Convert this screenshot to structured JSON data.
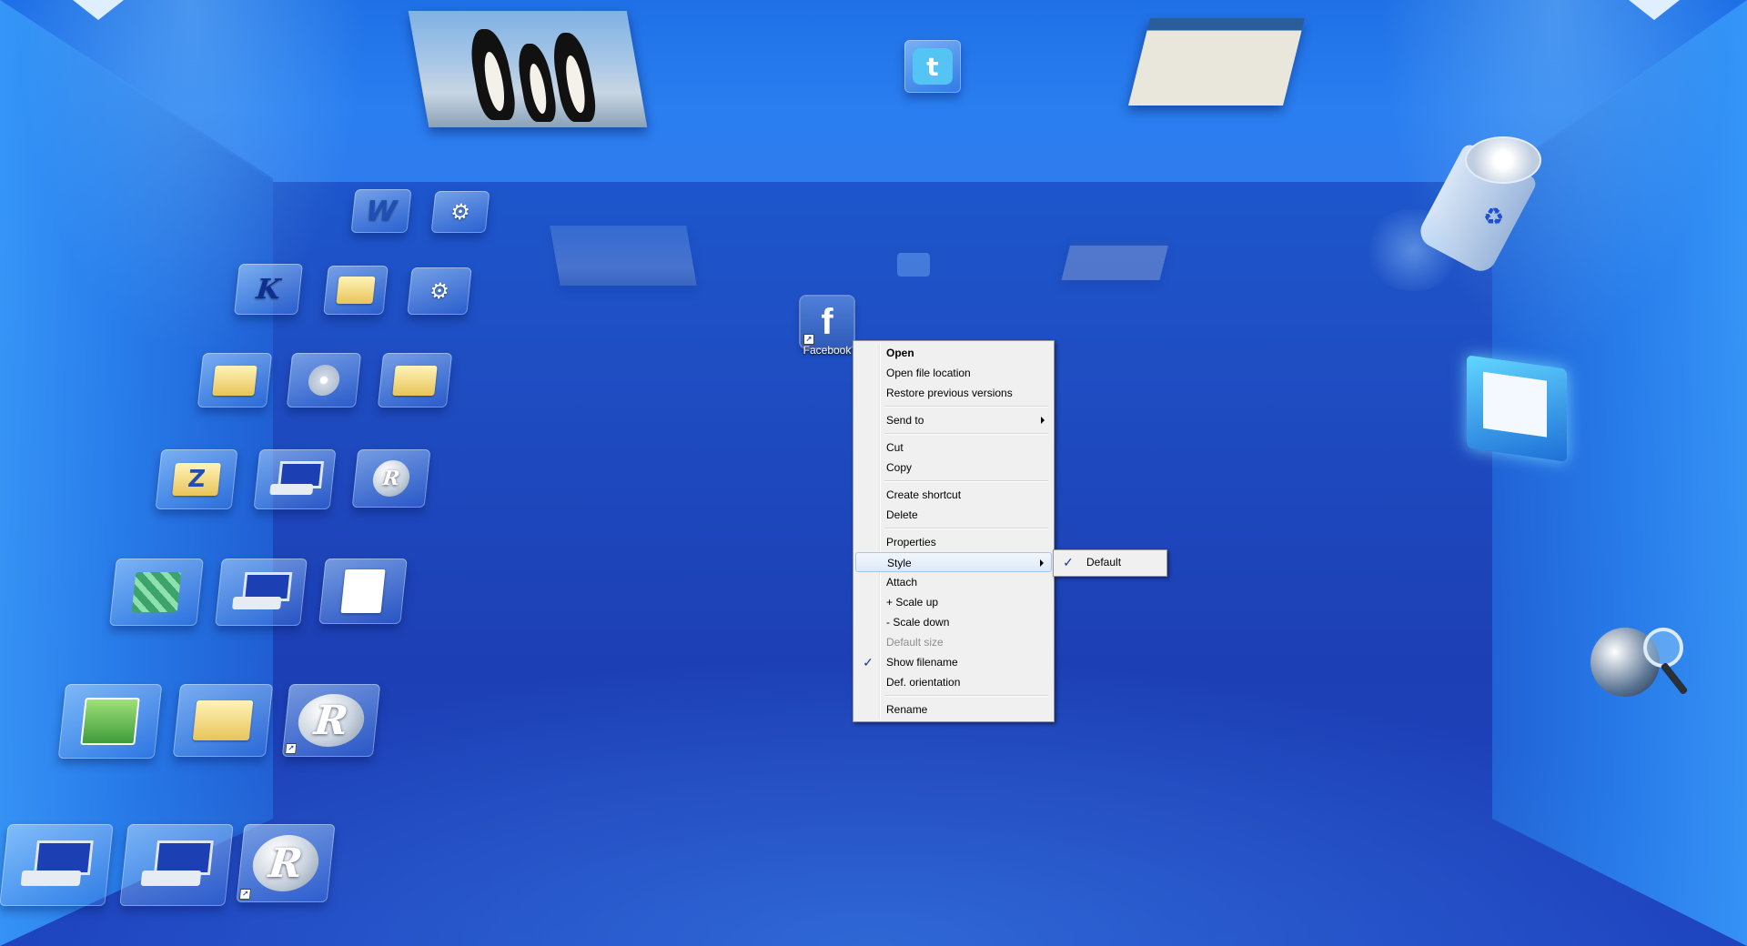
{
  "desktop": {
    "shortcut": {
      "label": "Facebook",
      "glyph": "f"
    }
  },
  "context_menu": {
    "items": [
      {
        "label": "Open"
      },
      {
        "label": "Open file location"
      },
      {
        "label": "Restore previous versions"
      },
      {
        "label": "Send to"
      },
      {
        "label": "Cut"
      },
      {
        "label": "Copy"
      },
      {
        "label": "Create shortcut"
      },
      {
        "label": "Delete"
      },
      {
        "label": "Properties"
      },
      {
        "label": "Style"
      },
      {
        "label": "Attach"
      },
      {
        "label": "+ Scale up"
      },
      {
        "label": "- Scale down"
      },
      {
        "label": "Default size"
      },
      {
        "label": "Show filename"
      },
      {
        "label": "Def. orientation"
      },
      {
        "label": "Rename"
      }
    ],
    "check_glyph": "✓"
  },
  "style_submenu": {
    "items": [
      {
        "label": "Default"
      }
    ]
  },
  "icons": {
    "word_glyph": "W",
    "kile_glyph": "K",
    "r_glyph": "R",
    "zip_glyph": "Z"
  }
}
